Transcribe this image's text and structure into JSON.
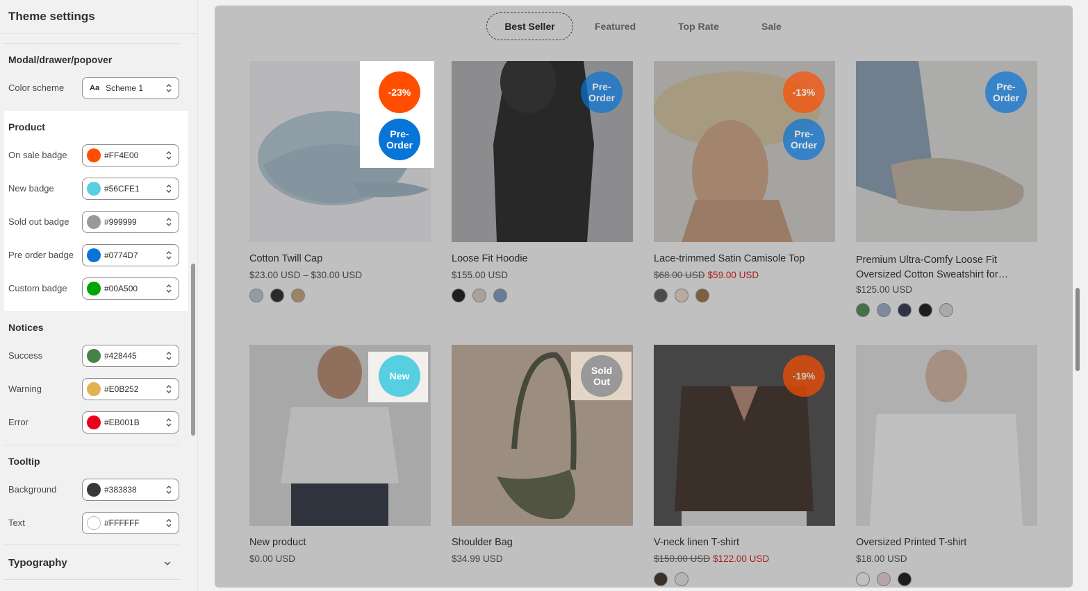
{
  "sidebar": {
    "title": "Theme settings",
    "modal": {
      "heading": "Modal/drawer/popover",
      "color_scheme_label": "Color scheme",
      "color_scheme_value": "Scheme 1",
      "color_scheme_icon": "Aa"
    },
    "product": {
      "heading": "Product",
      "rows": [
        {
          "label": "On sale badge",
          "value": "#FF4E00",
          "color": "#FF4E00"
        },
        {
          "label": "New badge",
          "value": "#56CFE1",
          "color": "#56CFE1"
        },
        {
          "label": "Sold out badge",
          "value": "#999999",
          "color": "#999999"
        },
        {
          "label": "Pre order badge",
          "value": "#0774D7",
          "color": "#0774D7"
        },
        {
          "label": "Custom badge",
          "value": "#00A500",
          "color": "#00A500"
        }
      ]
    },
    "notices": {
      "heading": "Notices",
      "rows": [
        {
          "label": "Success",
          "value": "#428445",
          "color": "#428445"
        },
        {
          "label": "Warning",
          "value": "#E0B252",
          "color": "#E0B252"
        },
        {
          "label": "Error",
          "value": "#EB001B",
          "color": "#EB001B"
        }
      ]
    },
    "tooltip": {
      "heading": "Tooltip",
      "rows": [
        {
          "label": "Background",
          "value": "#383838",
          "color": "#383838"
        },
        {
          "label": "Text",
          "value": "#FFFFFF",
          "color": "#FFFFFF"
        }
      ]
    },
    "typography": {
      "heading": "Typography"
    }
  },
  "tabs": [
    "Best Seller",
    "Featured",
    "Top Rate",
    "Sale"
  ],
  "products": [
    {
      "name": "Cotton Twill Cap",
      "price": "$23.00 USD – $30.00 USD",
      "badges": [
        "-23%",
        "Pre-Order"
      ]
    },
    {
      "name": "Loose Fit Hoodie",
      "price": "$155.00 USD",
      "badges": [
        "Pre-Order"
      ]
    },
    {
      "name": "Lace-trimmed Satin Camisole Top",
      "compare_price": "$68.00 USD",
      "sale_price": "$59.00 USD",
      "badges": [
        "-13%",
        "Pre-Order"
      ]
    },
    {
      "name": "Premium Ultra-Comfy Loose Fit Oversized Cotton Sweatshirt for…",
      "price": "$125.00 USD",
      "badges": [
        "Pre-Order"
      ]
    },
    {
      "name": "New product",
      "price": "$0.00 USD",
      "badges": [
        "New"
      ]
    },
    {
      "name": "Shoulder Bag",
      "price": "$34.99 USD",
      "badges": [
        "Sold Out"
      ]
    },
    {
      "name": "V-neck linen T-shirt",
      "compare_price": "$150.00 USD",
      "sale_price": "$122.00 USD",
      "badges": [
        "-19%"
      ]
    },
    {
      "name": "Oversized Printed T-shirt",
      "price": "$18.00 USD",
      "badges": []
    }
  ],
  "badge_text": {
    "pre_order_1": "Pre-",
    "pre_order_2": "Order",
    "sold_1": "Sold",
    "sold_2": "Out"
  }
}
